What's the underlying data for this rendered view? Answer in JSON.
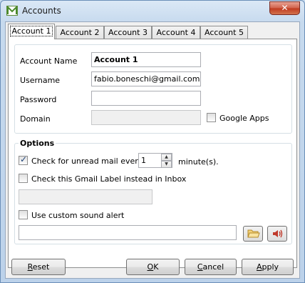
{
  "window": {
    "title": "Accounts"
  },
  "tabs": [
    {
      "label": "Account 1",
      "active": true
    },
    {
      "label": "Account 2",
      "active": false
    },
    {
      "label": "Account 3",
      "active": false
    },
    {
      "label": "Account 4",
      "active": false
    },
    {
      "label": "Account 5",
      "active": false
    }
  ],
  "account": {
    "name_label": "Account Name",
    "name_value": "Account 1",
    "username_label": "Username",
    "username_value": "fabio.boneschi@gmail.com",
    "password_label": "Password",
    "password_value": "",
    "domain_label": "Domain",
    "domain_value": "",
    "google_apps_label": "Google Apps",
    "google_apps_checked": false
  },
  "options": {
    "title": "Options",
    "check_unread_label": "Check for unread mail every",
    "check_unread_checked": true,
    "interval_value": "1",
    "interval_unit": "minute(s).",
    "gmail_label_option": "Check this Gmail Label instead in Inbox",
    "gmail_label_checked": false,
    "gmail_label_value": "",
    "custom_sound_label": "Use custom sound alert",
    "custom_sound_checked": false,
    "sound_file_value": ""
  },
  "buttons": {
    "reset_first": "R",
    "reset_rest": "eset",
    "ok_first": "O",
    "ok_rest": "K",
    "cancel_first": "C",
    "cancel_rest": "ancel",
    "apply_first": "A",
    "apply_rest": "pply"
  },
  "icons": {
    "app": "gmail-icon",
    "close": "close-icon",
    "browse": "folder-icon",
    "sound": "speaker-icon"
  }
}
